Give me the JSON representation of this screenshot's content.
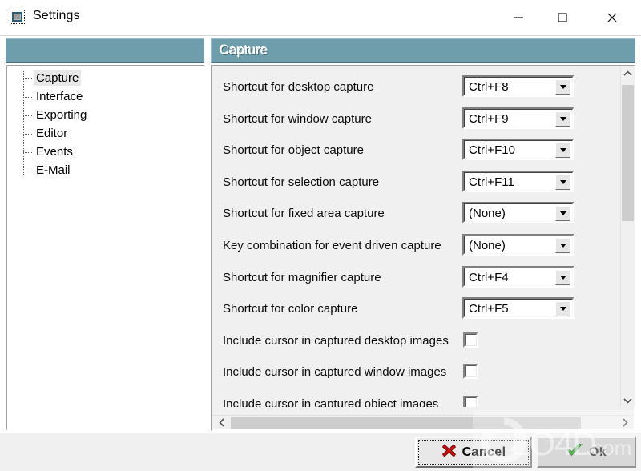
{
  "window": {
    "title": "Settings",
    "icon": "window-settings-icon",
    "controls": {
      "minimize": "minimize-icon",
      "maximize": "maximize-icon",
      "close": "close-icon"
    }
  },
  "sidebar": {
    "header": "",
    "items": [
      {
        "label": "Capture",
        "selected": true
      },
      {
        "label": "Interface",
        "selected": false
      },
      {
        "label": "Exporting",
        "selected": false
      },
      {
        "label": "Editor",
        "selected": false
      },
      {
        "label": "Events",
        "selected": false
      },
      {
        "label": "E-Mail",
        "selected": false
      }
    ]
  },
  "main": {
    "header": "Capture",
    "rows": [
      {
        "label": "Shortcut for desktop capture",
        "type": "combo",
        "value": "Ctrl+F8"
      },
      {
        "label": "Shortcut for window capture",
        "type": "combo",
        "value": "Ctrl+F9"
      },
      {
        "label": "Shortcut for object capture",
        "type": "combo",
        "value": "Ctrl+F10"
      },
      {
        "label": "Shortcut for selection capture",
        "type": "combo",
        "value": "Ctrl+F11"
      },
      {
        "label": "Shortcut for fixed area capture",
        "type": "combo",
        "value": "(None)"
      },
      {
        "label": "Key combination for event driven capture",
        "type": "combo",
        "value": "(None)"
      },
      {
        "label": "Shortcut for magnifier capture",
        "type": "combo",
        "value": "Ctrl+F4"
      },
      {
        "label": "Shortcut for color capture",
        "type": "combo",
        "value": "Ctrl+F5"
      },
      {
        "label": "Include cursor in captured desktop images",
        "type": "checkbox",
        "checked": false
      },
      {
        "label": "Include cursor in captured window images",
        "type": "checkbox",
        "checked": false
      },
      {
        "label": "Include cursor in captured object images",
        "type": "checkbox",
        "checked": false
      }
    ],
    "scroll": {
      "vertical_up": "chevron-up-icon",
      "vertical_down": "chevron-down-icon",
      "horizontal_left": "chevron-left-icon",
      "horizontal_right": "chevron-right-icon"
    }
  },
  "footer": {
    "cancel_label": "Cancel",
    "cancel_icon": "red-x-icon",
    "ok_label": "Ok",
    "ok_icon": "green-check-icon"
  },
  "watermark": {
    "text": "LO4D",
    "suffix": ".com"
  },
  "colors": {
    "header_teal": "#6e9dab",
    "dialog_face": "#f0f0f0",
    "cancel_icon": "#cc1111",
    "ok_icon": "#17a017"
  }
}
